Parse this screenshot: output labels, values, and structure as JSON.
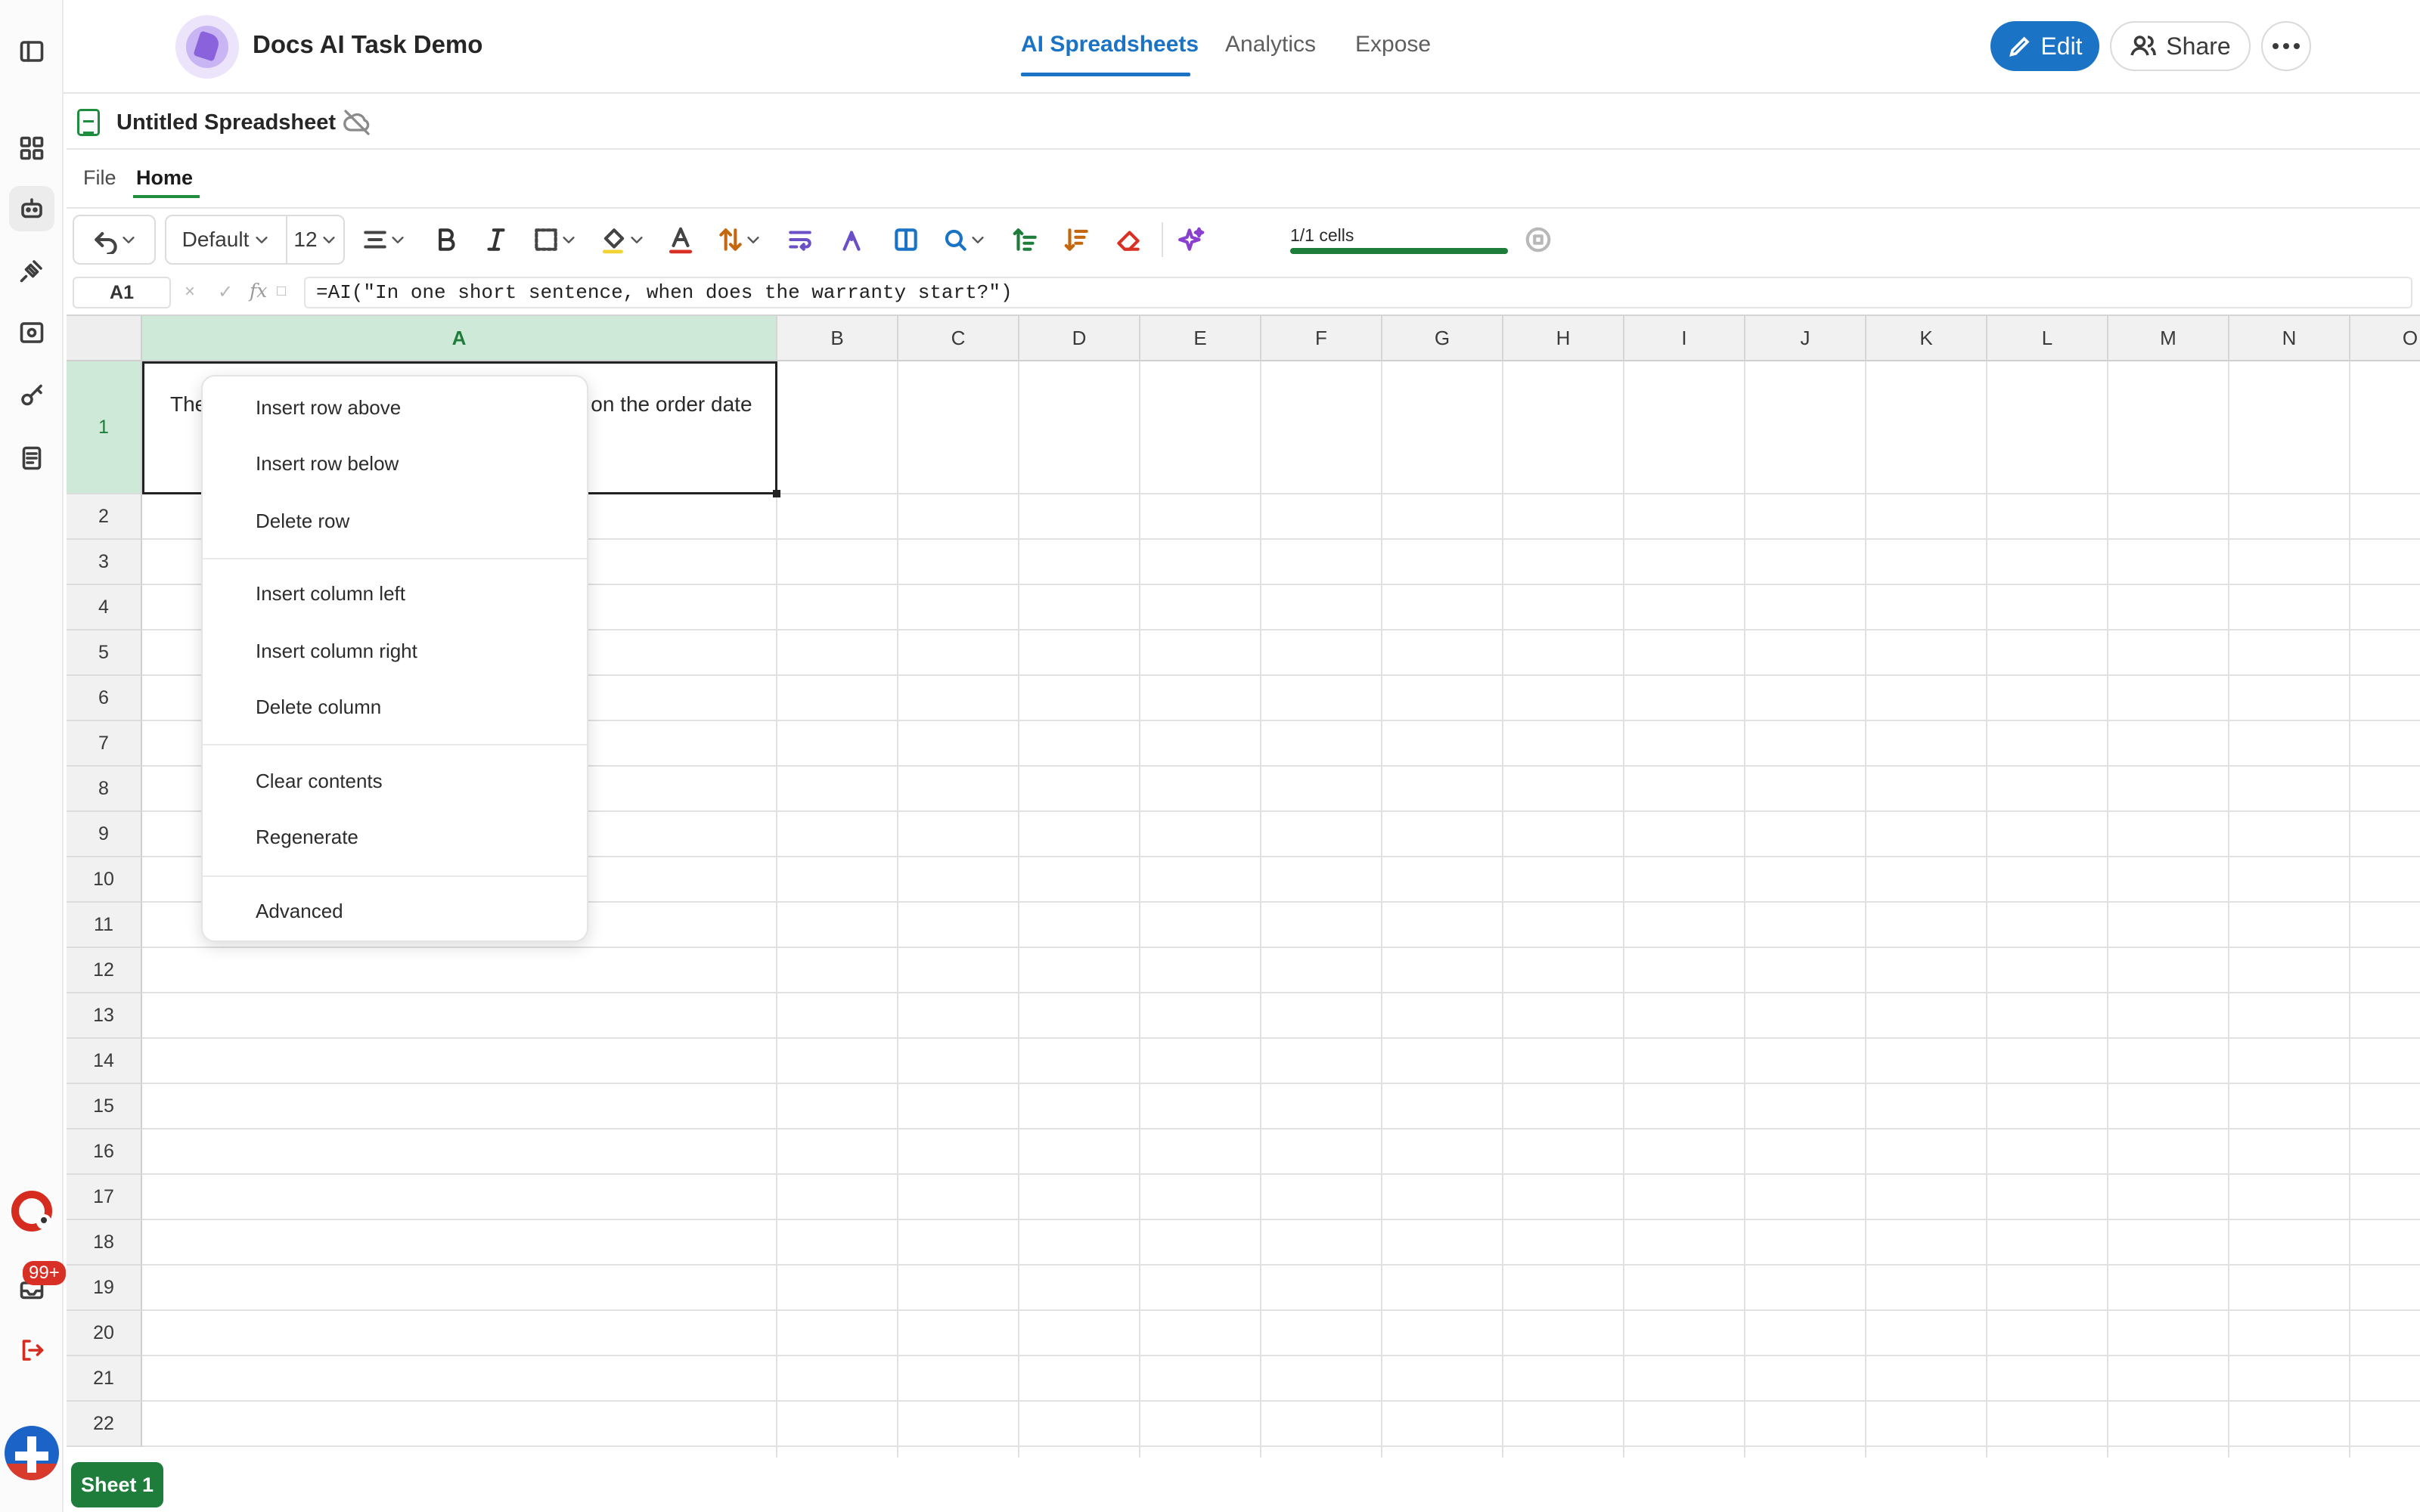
{
  "header": {
    "app_title": "Docs AI Task Demo",
    "nav_tabs": [
      {
        "label": "AI Spreadsheets",
        "active": true
      },
      {
        "label": "Analytics",
        "active": false
      },
      {
        "label": "Expose",
        "active": false
      }
    ],
    "edit_label": "Edit",
    "share_label": "Share",
    "accent_color": "#1a73c4"
  },
  "sidebar": {
    "icons": [
      "panel-toggle-icon",
      "grid-apps-icon",
      "robot-icon",
      "plug-icon",
      "dashboard-icon",
      "key-icon",
      "document-icon",
      "support-icon",
      "inbox-icon",
      "logout-icon"
    ],
    "badge": "99+"
  },
  "document": {
    "title": "Untitled Spreadsheet",
    "menu_tabs": [
      {
        "label": "File",
        "active": false
      },
      {
        "label": "Home",
        "active": true
      }
    ]
  },
  "toolbar": {
    "font_family": "Default",
    "font_size": "12",
    "ai_progress_label": "1/1 cells",
    "ai_progress_fraction": 1.0
  },
  "formula_bar": {
    "cell_ref": "A1",
    "fx_label": "fx",
    "formula": "=AI(\"In one short sentence, when does the warranty start?\")"
  },
  "grid": {
    "columns": [
      "A",
      "B",
      "C",
      "D",
      "E",
      "F",
      "G",
      "H",
      "I",
      "J",
      "K",
      "L",
      "M",
      "N",
      "O"
    ],
    "selected_column": "A",
    "rows": [
      "1",
      "2",
      "3",
      "4",
      "5",
      "6",
      "7",
      "8",
      "9",
      "10",
      "11",
      "12",
      "13",
      "14",
      "15",
      "16",
      "17",
      "18",
      "19",
      "20",
      "21",
      "22"
    ],
    "selected_row": "1",
    "cell_a1_left": "The",
    "cell_a1_right": "on the order date"
  },
  "context_menu": {
    "items": [
      "Insert row above",
      "Insert row below",
      "Delete row",
      "Insert column left",
      "Insert column right",
      "Delete column",
      "Clear contents",
      "Regenerate",
      "Advanced"
    ]
  },
  "sheets": {
    "active_label": "Sheet 1",
    "color": "#1e7d3a"
  }
}
